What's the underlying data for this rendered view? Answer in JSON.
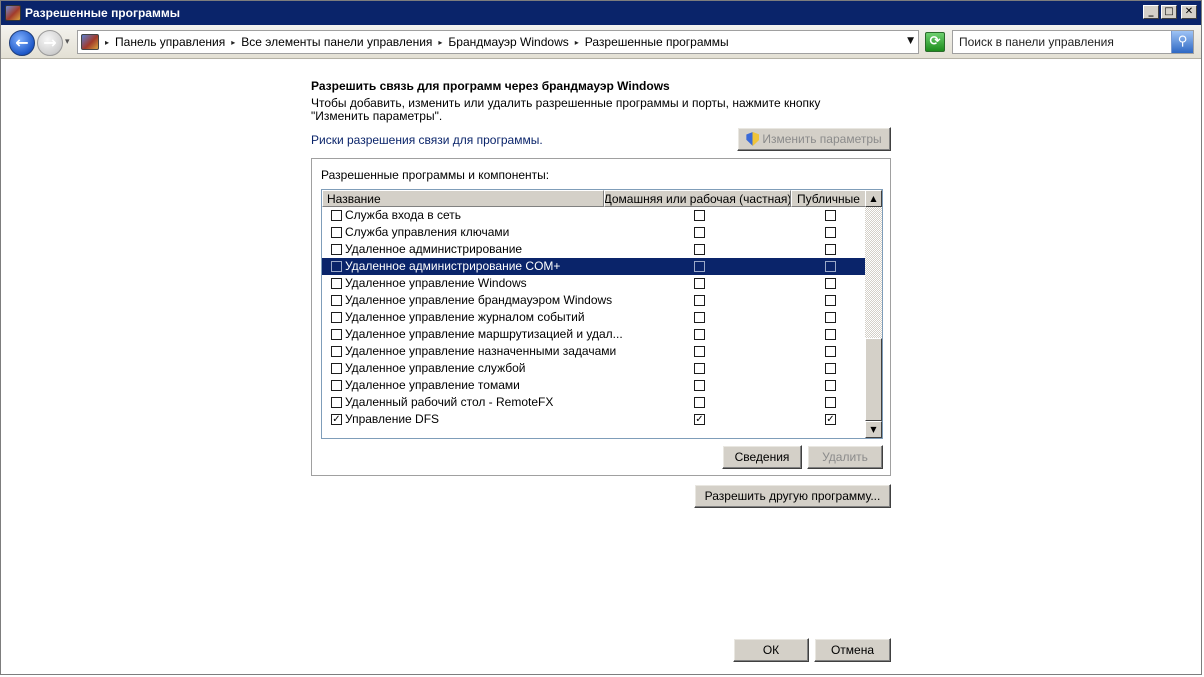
{
  "window": {
    "title": "Разрешенные программы",
    "controls": {
      "minimize": "_",
      "maximize": "□",
      "close": "✕"
    }
  },
  "address": {
    "back_glyph": "←",
    "forward_glyph": "→",
    "history_glyph": "▾",
    "sep_glyph": "▸",
    "dropdown_glyph": "▼",
    "breadcrumbs": [
      "Панель управления",
      "Все элементы панели управления",
      "Брандмауэр Windows",
      "Разрешенные программы"
    ],
    "refresh_glyph": "⟳",
    "search_placeholder": "Поиск в панели управления",
    "search_glyph": "⚲"
  },
  "main": {
    "heading": "Разрешить связь для программ через брандмауэр Windows",
    "description": "Чтобы добавить, изменить или удалить разрешенные программы и порты, нажмите кнопку \"Изменить параметры\".",
    "risk_link": "Риски разрешения связи для программы.",
    "change_settings_label": "Изменить параметры",
    "group_label": "Разрешенные программы и компоненты:",
    "columns": {
      "name": "Название",
      "home": "Домашняя или рабочая (частная)",
      "public": "Публичные"
    },
    "scroll": {
      "up_glyph": "▲",
      "down_glyph": "▼"
    },
    "check_glyph": "✓",
    "rows": [
      {
        "name": "Служба входа в сеть",
        "enabled": false,
        "home": false,
        "public": false,
        "selected": false
      },
      {
        "name": "Служба управления ключами",
        "enabled": false,
        "home": false,
        "public": false,
        "selected": false
      },
      {
        "name": "Удаленное администрирование",
        "enabled": false,
        "home": false,
        "public": false,
        "selected": false
      },
      {
        "name": "Удаленное администрирование COM+",
        "enabled": false,
        "home": false,
        "public": false,
        "selected": true
      },
      {
        "name": "Удаленное управление Windows",
        "enabled": false,
        "home": false,
        "public": false,
        "selected": false
      },
      {
        "name": "Удаленное управление брандмауэром Windows",
        "enabled": false,
        "home": false,
        "public": false,
        "selected": false
      },
      {
        "name": "Удаленное управление журналом событий",
        "enabled": false,
        "home": false,
        "public": false,
        "selected": false
      },
      {
        "name": "Удаленное управление маршрутизацией и удал...",
        "enabled": false,
        "home": false,
        "public": false,
        "selected": false
      },
      {
        "name": "Удаленное управление назначенными задачами",
        "enabled": false,
        "home": false,
        "public": false,
        "selected": false
      },
      {
        "name": "Удаленное управление службой",
        "enabled": false,
        "home": false,
        "public": false,
        "selected": false
      },
      {
        "name": "Удаленное управление томами",
        "enabled": false,
        "home": false,
        "public": false,
        "selected": false
      },
      {
        "name": "Удаленный рабочий стол - RemoteFX",
        "enabled": false,
        "home": false,
        "public": false,
        "selected": false
      },
      {
        "name": "Управление DFS",
        "enabled": true,
        "home": true,
        "public": true,
        "selected": false
      }
    ],
    "details_label": "Сведения",
    "delete_label": "Удалить",
    "allow_other_label": "Разрешить другую программу..."
  },
  "footer": {
    "ok_label": "ОК",
    "cancel_label": "Отмена"
  },
  "colors": {
    "titlebar": "#0a246a",
    "selection": "#0a246a",
    "link": "#0a246a",
    "button_face": "#d4d0c8"
  }
}
